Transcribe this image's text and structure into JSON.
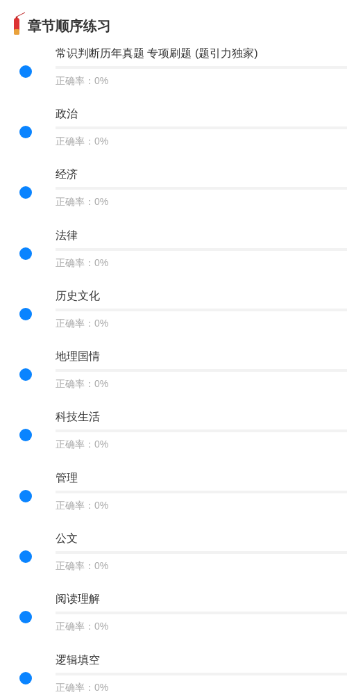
{
  "header": {
    "title": "章节顺序练习"
  },
  "chapters": [
    {
      "name": "常识判断历年真题 专项刷题 (题引力独家)",
      "accuracy": "正确率：0%",
      "level": 0
    },
    {
      "name": "政治",
      "accuracy": "正确率：0%",
      "level": 0
    },
    {
      "name": "经济",
      "accuracy": "正确率：0%",
      "level": 0
    },
    {
      "name": "法律",
      "accuracy": "正确率：0%",
      "level": 0
    },
    {
      "name": "历史文化",
      "accuracy": "正确率：0%",
      "level": 0
    },
    {
      "name": "地理国情",
      "accuracy": "正确率：0%",
      "level": 0
    },
    {
      "name": "科技生活",
      "accuracy": "正确率：0%",
      "level": 0
    },
    {
      "name": "管理",
      "accuracy": "正确率：0%",
      "level": 0
    },
    {
      "name": "公文",
      "accuracy": "正确率：0%",
      "level": 0
    },
    {
      "name": "阅读理解",
      "accuracy": "正确率：0%",
      "level": 0
    },
    {
      "name": "逻辑填空",
      "accuracy": "正确率：0%",
      "level": 0
    }
  ]
}
